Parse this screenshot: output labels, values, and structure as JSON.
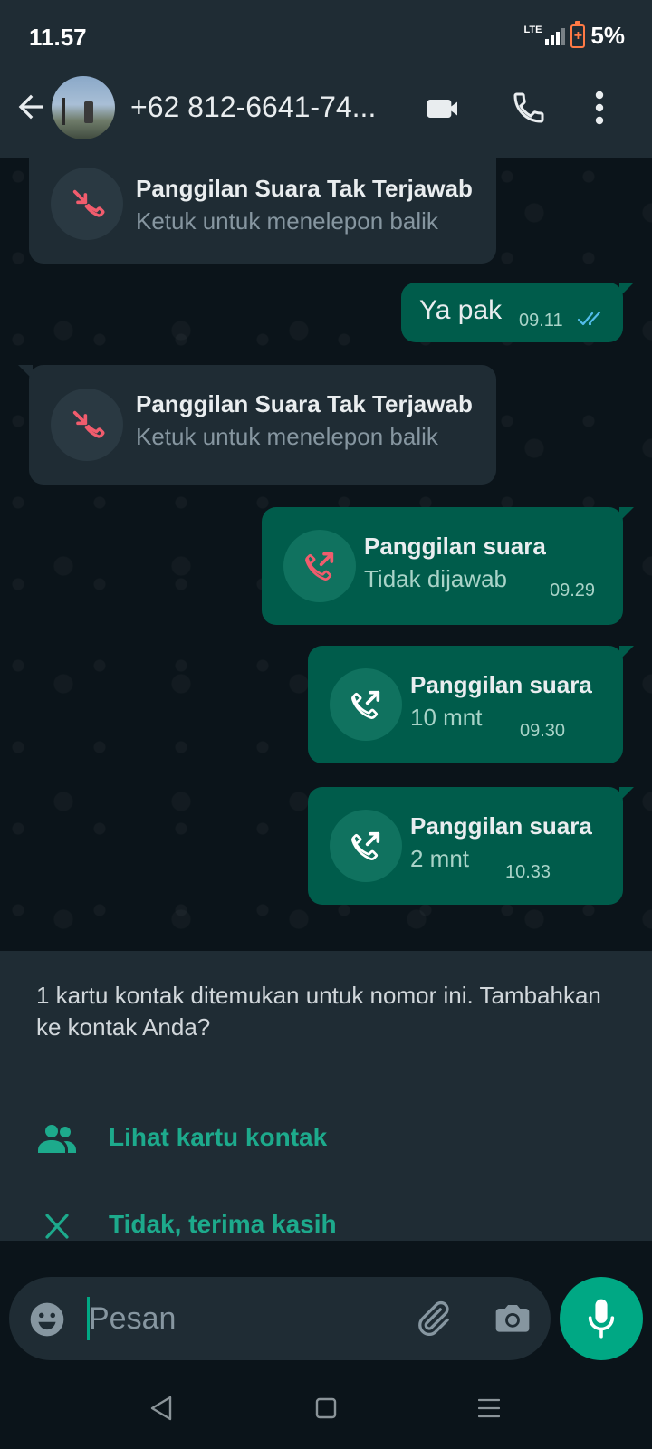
{
  "status_bar": {
    "time": "11.57",
    "network": "LTE",
    "battery": "5%"
  },
  "header": {
    "contact_name": "+62 812-6641-74...",
    "icons": [
      "back-arrow-icon",
      "video-call-icon",
      "voice-call-icon",
      "more-options-icon"
    ]
  },
  "chat": {
    "messages": [
      {
        "direction": "incoming",
        "kind": "call",
        "icon": "missed-call-icon",
        "title": "Panggilan Suara Tak Terjawab",
        "subtitle": "Ketuk untuk menelepon balik"
      },
      {
        "direction": "outgoing",
        "kind": "text",
        "text": "Ya pak",
        "time": "09.11",
        "status": "read"
      },
      {
        "direction": "incoming",
        "kind": "call",
        "icon": "missed-call-icon",
        "title": "Panggilan Suara Tak Terjawab",
        "subtitle": "Ketuk untuk menelepon balik"
      },
      {
        "direction": "outgoing",
        "kind": "call",
        "icon": "outgoing-call-icon",
        "title": "Panggilan suara",
        "subtitle": "Tidak dijawab",
        "time": "09.29"
      },
      {
        "direction": "outgoing",
        "kind": "call",
        "icon": "outgoing-call-icon",
        "title": "Panggilan suara",
        "subtitle": "10 mnt",
        "time": "09.30"
      },
      {
        "direction": "outgoing",
        "kind": "call",
        "icon": "outgoing-call-icon",
        "title": "Panggilan suara",
        "subtitle": "2 mnt",
        "time": "10.33"
      }
    ]
  },
  "contact_card": {
    "message": "1 kartu kontak ditemukan untuk nomor ini. Tambahkan ke kontak Anda?",
    "view_label": "Lihat kartu kontak",
    "dismiss_label": "Tidak, terima kasih"
  },
  "composer": {
    "placeholder": "Pesan",
    "icons": [
      "emoji-icon",
      "attach-icon",
      "camera-icon",
      "mic-icon"
    ]
  },
  "colors": {
    "accent": "#00a884",
    "missed": "#f15c6d",
    "outgoing_bubble": "#005c4b",
    "incoming_bubble": "#1f2c34",
    "read_ticks": "#53bdeb"
  }
}
